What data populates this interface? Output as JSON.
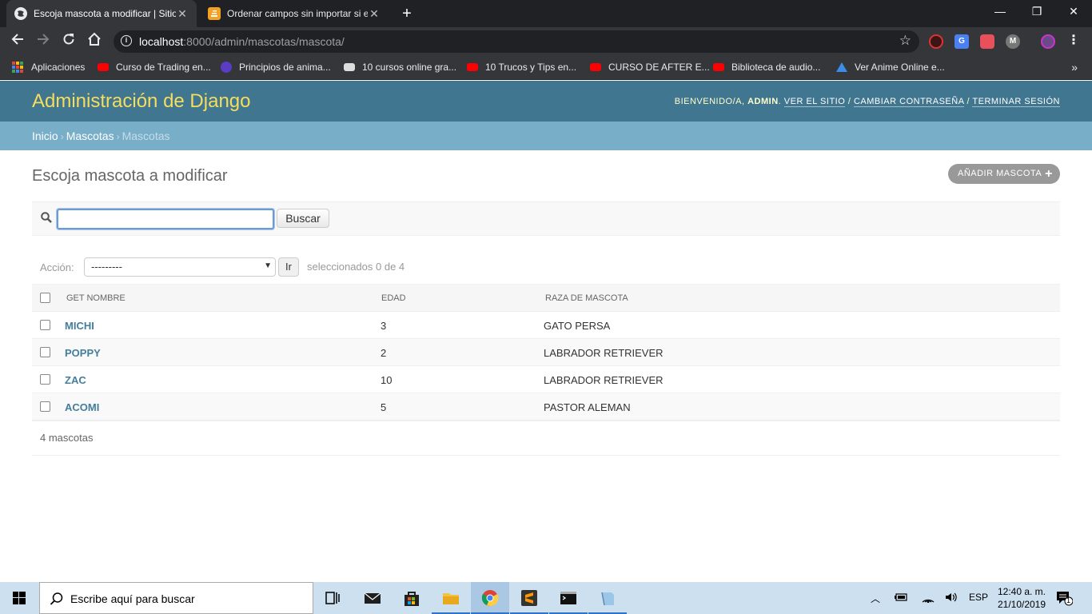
{
  "browser": {
    "tabs": [
      {
        "title": "Escoja mascota a modificar | Sitio",
        "close": "✕"
      },
      {
        "title": "Ordenar campos sin importar si e",
        "close": "✕"
      }
    ],
    "new_tab": "+",
    "url_host": "localhost",
    "url_path": ":8000/admin/mascotas/mascota/",
    "window_controls": {
      "minimize": "—",
      "restore": "❐",
      "close": "✕"
    }
  },
  "bookmarks": [
    {
      "label": "Aplicaciones",
      "icon": "apps-icon"
    },
    {
      "label": "Curso de Trading en...",
      "icon": "youtube-icon",
      "color": "#ff0000"
    },
    {
      "label": "Principios de anima...",
      "icon": "site-icon",
      "color": "#5b3cc4"
    },
    {
      "label": "10 cursos online gra...",
      "icon": "chat-icon",
      "color": "#dddddd"
    },
    {
      "label": "10 Trucos y Tips en...",
      "icon": "youtube-icon",
      "color": "#ff0000"
    },
    {
      "label": "CURSO DE AFTER E...",
      "icon": "youtube-icon",
      "color": "#ff0000"
    },
    {
      "label": "Biblioteca de audio...",
      "icon": "youtube-icon",
      "color": "#ff0000"
    },
    {
      "label": "Ver Anime Online e...",
      "icon": "anime-icon",
      "color": "#3a8ee6"
    }
  ],
  "bookmarks_more": "»",
  "django": {
    "branding": "Administración de Django",
    "welcome": "Bienvenido/a,",
    "user": "admin",
    "links": {
      "view_site": "Ver el sitio",
      "change_password": "Cambiar contraseña",
      "logout": "Terminar sesión"
    },
    "breadcrumbs": {
      "home": "Inicio",
      "app": "Mascotas",
      "current": "Mascotas"
    },
    "page_title": "Escoja mascota a modificar",
    "add_button": "Añadir mascota",
    "search_button": "Buscar",
    "search_value": "",
    "action_label": "Acción:",
    "action_selected": "---------",
    "action_go": "Ir",
    "action_counter": "seleccionados 0 de 4",
    "columns": [
      "Get nombre",
      "Edad",
      "Raza de mascota"
    ],
    "rows": [
      {
        "name": "MICHI",
        "age": "3",
        "breed": "GATO PERSA"
      },
      {
        "name": "POPPY",
        "age": "2",
        "breed": "LABRADOR RETRIEVER"
      },
      {
        "name": "ZAC",
        "age": "10",
        "breed": "LABRADOR RETRIEVER"
      },
      {
        "name": "ACOMI",
        "age": "5",
        "breed": "PASTOR ALEMAN"
      }
    ],
    "paginator": "4 mascotas"
  },
  "taskbar": {
    "search_placeholder": "Escribe aquí para buscar",
    "language": "ESP",
    "time": "12:40 a. m.",
    "date": "21/10/2019",
    "notifications": "1"
  }
}
